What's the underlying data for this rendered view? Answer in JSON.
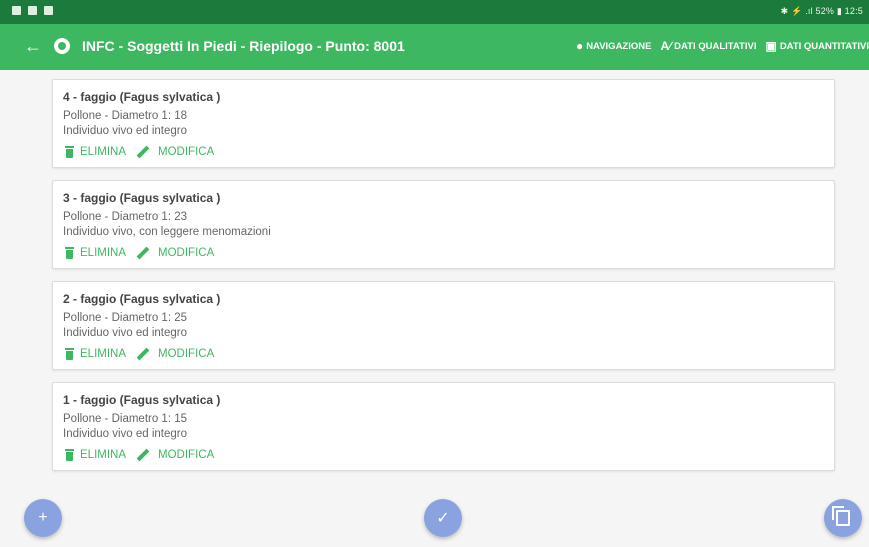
{
  "status_bar": {
    "right_text": "✱ ⚡ .ıl 52% ▮ 12:5"
  },
  "app_bar": {
    "title": "INFC - Soggetti In Piedi - Riepilogo - Punto: 8001",
    "actions": [
      {
        "label": "NAVIGAZIONE",
        "icon": "location-icon"
      },
      {
        "label": "DATI QUALITATIVI",
        "icon": "qualitative-icon"
      },
      {
        "label": "DATI QUANTITATIVI",
        "icon": "quantitative-icon"
      }
    ]
  },
  "cards": [
    {
      "title": "4 - faggio (Fagus sylvatica )",
      "line1": "Pollone - Diametro 1: 18",
      "line2": "Individuo vivo ed integro",
      "delete_label": "ELIMINA",
      "edit_label": "MODIFICA"
    },
    {
      "title": "3 - faggio (Fagus sylvatica )",
      "line1": "Pollone - Diametro 1: 23",
      "line2": "Individuo vivo, con leggere menomazioni",
      "delete_label": "ELIMINA",
      "edit_label": "MODIFICA"
    },
    {
      "title": "2 - faggio (Fagus sylvatica )",
      "line1": "Pollone - Diametro 1: 25",
      "line2": "Individuo vivo ed integro",
      "delete_label": "ELIMINA",
      "edit_label": "MODIFICA"
    },
    {
      "title": "1 - faggio (Fagus sylvatica )",
      "line1": "Pollone - Diametro 1: 15",
      "line2": "Individuo vivo ed integro",
      "delete_label": "ELIMINA",
      "edit_label": "MODIFICA"
    }
  ],
  "fabs": {
    "add": "+",
    "done": "✓"
  },
  "colors": {
    "primary": "#3db861",
    "primary_dark": "#1b7a3c",
    "fab": "#8aa3e0"
  }
}
